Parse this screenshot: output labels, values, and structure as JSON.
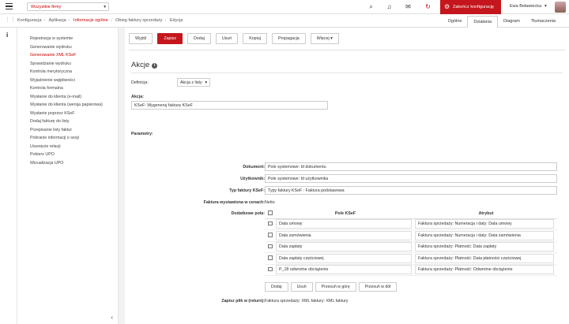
{
  "topbar": {
    "company_select": "Wszystkie firmy",
    "close_config": "Zakończ konfigurację",
    "user": "Ewa Beławiecka"
  },
  "breadcrumb": [
    "Konfiguracja",
    "Aplikacja",
    "Informacje ogólne",
    "Obieg faktury sprzedaży",
    "Edycja"
  ],
  "right_tabs": [
    "Ogólne",
    "Działania",
    "Diagram",
    "Tłumaczenia"
  ],
  "sidebar_items": [
    "Rejestracja w systemie",
    "Generowanie wydruku",
    "Generowanie XML KSeF",
    "Sprawdzanie wydruku",
    "Kontrola merytoryczna",
    "Wyjaśnienie wątpliwości",
    "Kontrola formalna",
    "Wysłanie do klienta (e-mail)",
    "Wysłanie do klienta (wersja papierowa)",
    "Wysłanie poprzez KSeF",
    "Dodaj fakturę do listy",
    "Przepisanie listy faktur",
    "Pobranie informacji o sesji",
    "Usunięcie relacji",
    "Pobierz UPO",
    "Wizualizacja UPO"
  ],
  "toolbar": {
    "back": "Wyjdź",
    "save": "Zapisz",
    "add": "Dodaj",
    "remove": "Usuń",
    "copy": "Kopiuj",
    "propagate": "Propagacja",
    "more": "Więcej"
  },
  "form": {
    "title": "Akcje",
    "definition_label": "Definicja:",
    "definition_value": "Akcja z listy",
    "action_label": "Akcja:",
    "action_value": "KSeF: Wygeneruj fakturę KSeF",
    "params_label": "Parametry:",
    "params": [
      {
        "label": "Dokument:",
        "value": "Pole systemowe: Id dokumentu"
      },
      {
        "label": "Użytkownik:",
        "value": "Pole systemowe: Id użytkownika"
      },
      {
        "label": "Typ faktury KSeF:",
        "value": "Typy faktury KSeF : Faktura podstawowa"
      },
      {
        "label": "Faktura wystawiona w cenach:",
        "value": "Netto"
      }
    ],
    "extra_label": "Dodatkowe pola:",
    "grid_headers": [
      "Pole KSeF",
      "Atrybut"
    ],
    "grid_rows": [
      {
        "field": "Data umowy",
        "attr": "Faktura sprzedaży: Numeracja i daty: Data umowy"
      },
      {
        "field": "Data zamówienia",
        "attr": "Faktura sprzedaży: Numeracja i daty: Data zamówienia"
      },
      {
        "field": "Data zapłaty",
        "attr": "Faktura sprzedaży: Płatność: Data zapłaty"
      },
      {
        "field": "Data zapłaty częściowej",
        "attr": "Faktura sprzedaży: Płatność: Data płatności częściowej"
      },
      {
        "field": "P_18 odwrotne obciążenie",
        "attr": "Faktura sprzedaży: Płatność: Odwrotne obciążenie"
      }
    ],
    "grid_buttons": [
      "Dodaj",
      "Usuń",
      "Przesuń w górę",
      "Przesuń w dół"
    ],
    "save_file_label": "Zapisz plik w (return):",
    "save_file_value": "Faktura sprzedaży: XML faktury: XML faktury"
  },
  "colors": {
    "accent": "#c4161c"
  }
}
